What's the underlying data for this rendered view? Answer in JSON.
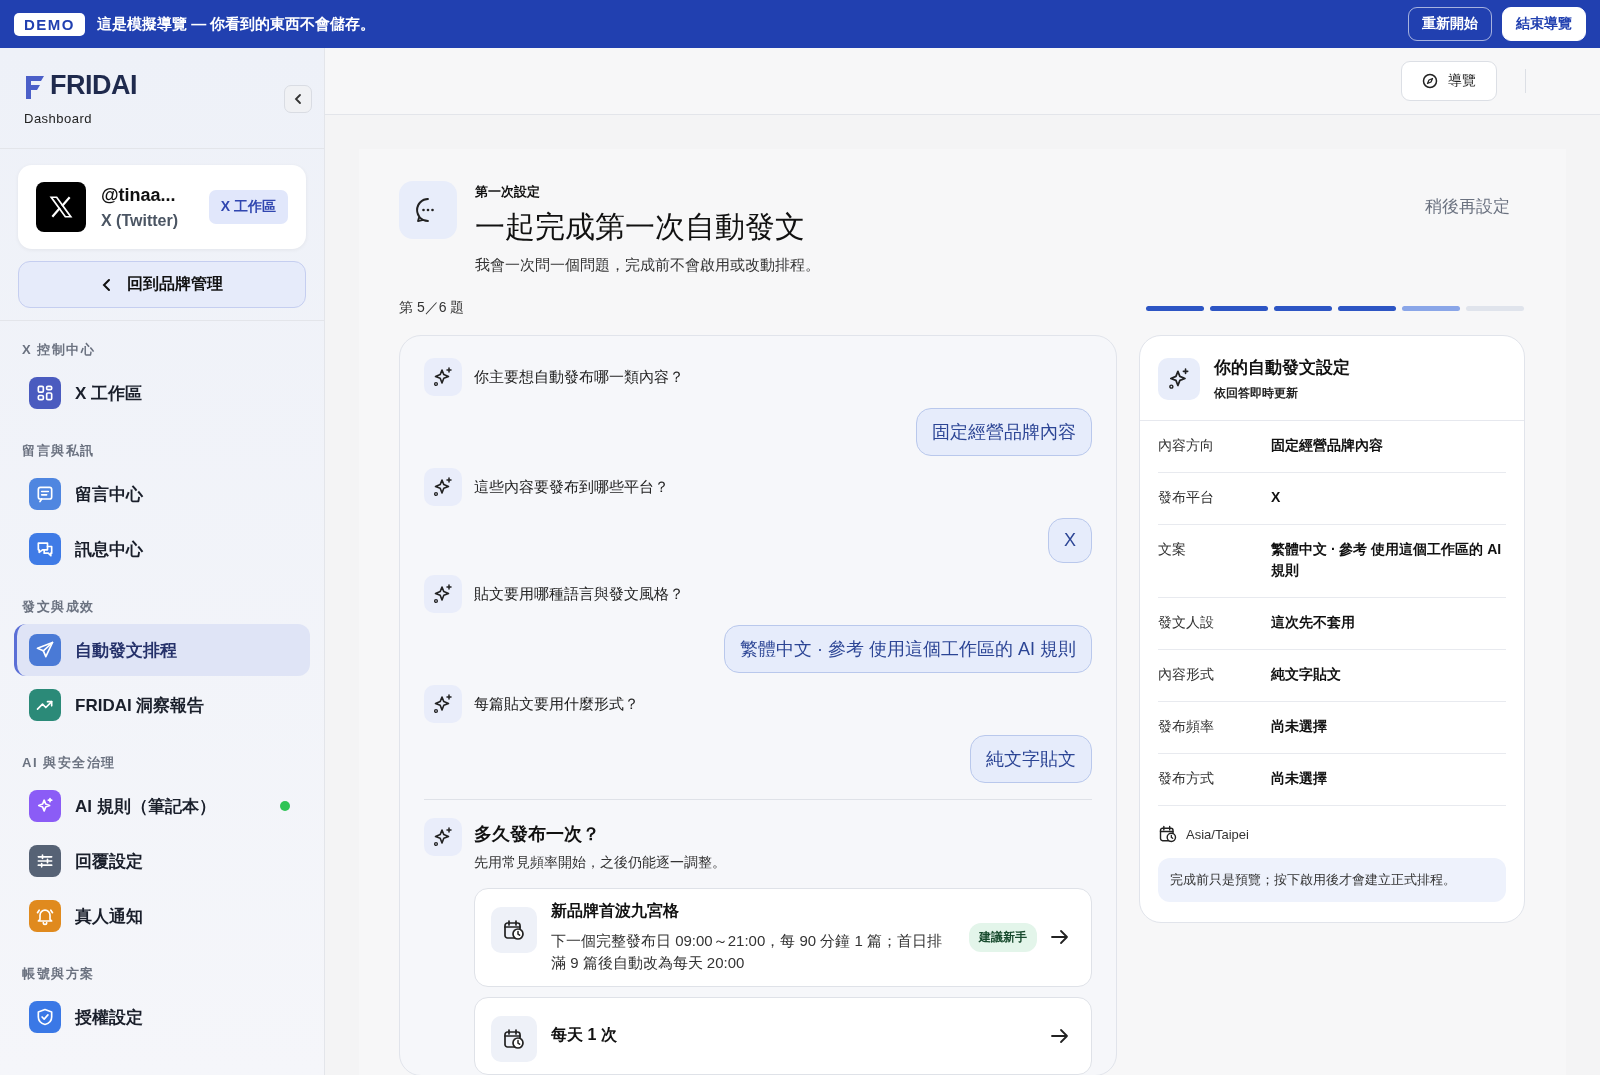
{
  "banner": {
    "badge": "DEMO",
    "message": "這是模擬導覽 — 你看到的東西不會儲存。",
    "buttons": [
      {
        "label": "重新開始",
        "kind": "outline"
      },
      {
        "label": "結束導覽",
        "kind": "solid"
      }
    ]
  },
  "sidebar": {
    "brand": {
      "logo": "FRIDAI",
      "subtitle": "Dashboard"
    },
    "account": {
      "handle": "@tinaa...",
      "platform": "X (Twitter)",
      "badge": "X 工作區"
    },
    "back_button": "回到品牌管理",
    "sections": [
      {
        "title": "X 控制中心",
        "items": [
          {
            "label": "X 工作區",
            "kind": "grid",
            "color": "#4a5bbf",
            "selected": false,
            "online": false
          }
        ]
      },
      {
        "title": "留言與私訊",
        "items": [
          {
            "label": "留言中心",
            "kind": "comment",
            "color": "#4f86e0",
            "selected": false,
            "online": false
          },
          {
            "label": "訊息中心",
            "kind": "chat",
            "color": "#3f7be6",
            "selected": false,
            "online": false
          }
        ]
      },
      {
        "title": "發文與成效",
        "items": [
          {
            "label": "自動發文排程",
            "kind": "send",
            "color": "#4a7ad6",
            "selected": true,
            "online": false
          },
          {
            "label": "FRIDAI 洞察報告",
            "kind": "trend",
            "color": "#2b8a78",
            "selected": false,
            "online": false
          }
        ]
      },
      {
        "title": "AI 與安全治理",
        "items": [
          {
            "label": "AI 規則（筆記本）",
            "kind": "sparkle",
            "color": "#8b5cf6",
            "selected": false,
            "online": true
          },
          {
            "label": "回覆設定",
            "kind": "sliders",
            "color": "#566275",
            "selected": false,
            "online": false
          },
          {
            "label": "真人通知",
            "kind": "bell",
            "color": "#e08a1e",
            "selected": false,
            "online": false
          }
        ]
      },
      {
        "title": "帳號與方案",
        "items": [
          {
            "label": "授權設定",
            "kind": "shield",
            "color": "#3a78e6",
            "selected": false,
            "online": false
          }
        ]
      }
    ]
  },
  "topbar": {
    "tour_button": "導覽"
  },
  "setup": {
    "eyebrow": "第一次設定",
    "title": "一起完成第一次自動發文",
    "description": "我會一次問一個問題，完成前不會啟用或改動排程。",
    "skip": "稍後再設定",
    "progress": {
      "label": "第 5／6 題",
      "steps": [
        {
          "kind": "done"
        },
        {
          "kind": "done"
        },
        {
          "kind": "done"
        },
        {
          "kind": "done"
        },
        {
          "kind": "current"
        },
        {
          "kind": "todo"
        }
      ]
    },
    "messages": [
      {
        "kind": "bot",
        "text": "你主要想自動發布哪一類內容？"
      },
      {
        "kind": "user",
        "text": "固定經營品牌內容"
      },
      {
        "kind": "bot",
        "text": "這些內容要發布到哪些平台？"
      },
      {
        "kind": "user",
        "text": "X"
      },
      {
        "kind": "bot",
        "text": "貼文要用哪種語言與發文風格？"
      },
      {
        "kind": "user",
        "text": "繁體中文 · 參考 使用這個工作區的 AI 規則"
      },
      {
        "kind": "bot",
        "text": "每篇貼文要用什麼形式？"
      },
      {
        "kind": "user",
        "text": "純文字貼文"
      }
    ],
    "question": {
      "title": "多久發布一次？",
      "hint": "先用常見頻率開始，之後仍能逐一調整。",
      "options": [
        {
          "title": "新品牌首波九宮格",
          "description": "下一個完整發布日 09:00～21:00，每 90 分鐘 1 篇；首日排滿 9 篇後自動改為每天 20:00",
          "badge": "建議新手"
        },
        {
          "title": "每天 1 次"
        }
      ]
    }
  },
  "summary": {
    "title": "你的自動發文設定",
    "subtitle": "依回答即時更新",
    "rows": [
      {
        "label": "內容方向",
        "value": "固定經營品牌內容"
      },
      {
        "label": "發布平台",
        "value": "X"
      },
      {
        "label": "文案",
        "value": "繁體中文 · 參考 使用這個工作區的 AI 規則"
      },
      {
        "label": "發文人設",
        "value": "這次先不套用"
      },
      {
        "label": "內容形式",
        "value": "純文字貼文"
      },
      {
        "label": "發布頻率",
        "value": "尚未選擇"
      },
      {
        "label": "發布方式",
        "value": "尚未選擇"
      }
    ],
    "timezone": "Asia/Taipei",
    "note": "完成前只是預覽；按下啟用後才會建立正式排程。"
  }
}
